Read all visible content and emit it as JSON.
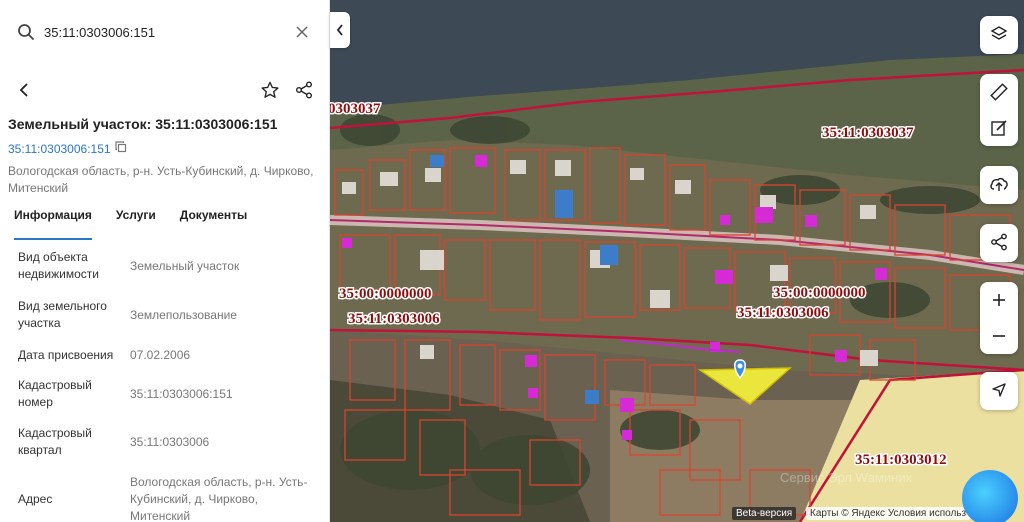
{
  "search": {
    "value": "35:11:0303006:151",
    "icon": "search-icon"
  },
  "card": {
    "title": "Земельный участок: 35:11:0303006:151",
    "cad_link": "35:11:0303006:151",
    "address_line": "Вологодская область, р-н. Усть-Кубинский, д. Чирково, Митенский"
  },
  "tabs": [
    {
      "label": "Информация",
      "active": true
    },
    {
      "label": "Услуги",
      "active": false
    },
    {
      "label": "Документы",
      "active": false
    }
  ],
  "props": [
    {
      "key": "Вид объекта недвижимости",
      "value": "Земельный участок"
    },
    {
      "key": "Вид земельного участка",
      "value": "Землепользование"
    },
    {
      "key": "Дата присвоения",
      "value": "07.02.2006"
    },
    {
      "key": "Кадастровый номер",
      "value": "35:11:0303006:151"
    },
    {
      "key": "Кадастровый квартал",
      "value": "35:11:0303006"
    },
    {
      "key": "Адрес",
      "value": "Вологодская область, р-н. Усть-Кубинский, д. Чирково, Митенский"
    }
  ],
  "map": {
    "labels": {
      "q037_left": "0303037",
      "q037_right": "35:11:0303037",
      "q000_left": "35:00:0000000",
      "q000_right": "35:00:0000000",
      "q006_left": "35:11:0303006",
      "q006_right": "35:11:0303006",
      "q012": "35:11:0303012"
    },
    "watermark": "Сервис Эрл Wаминих",
    "beta": "Beta-версия",
    "attribution": "Карты © Яндекс   Условия использ",
    "colors": {
      "boundary": "#d8442f",
      "quarter": "#c0123a",
      "road": "#b8a3a3",
      "selected": "#f2ee3a",
      "magenta": "#d62ad6"
    }
  }
}
